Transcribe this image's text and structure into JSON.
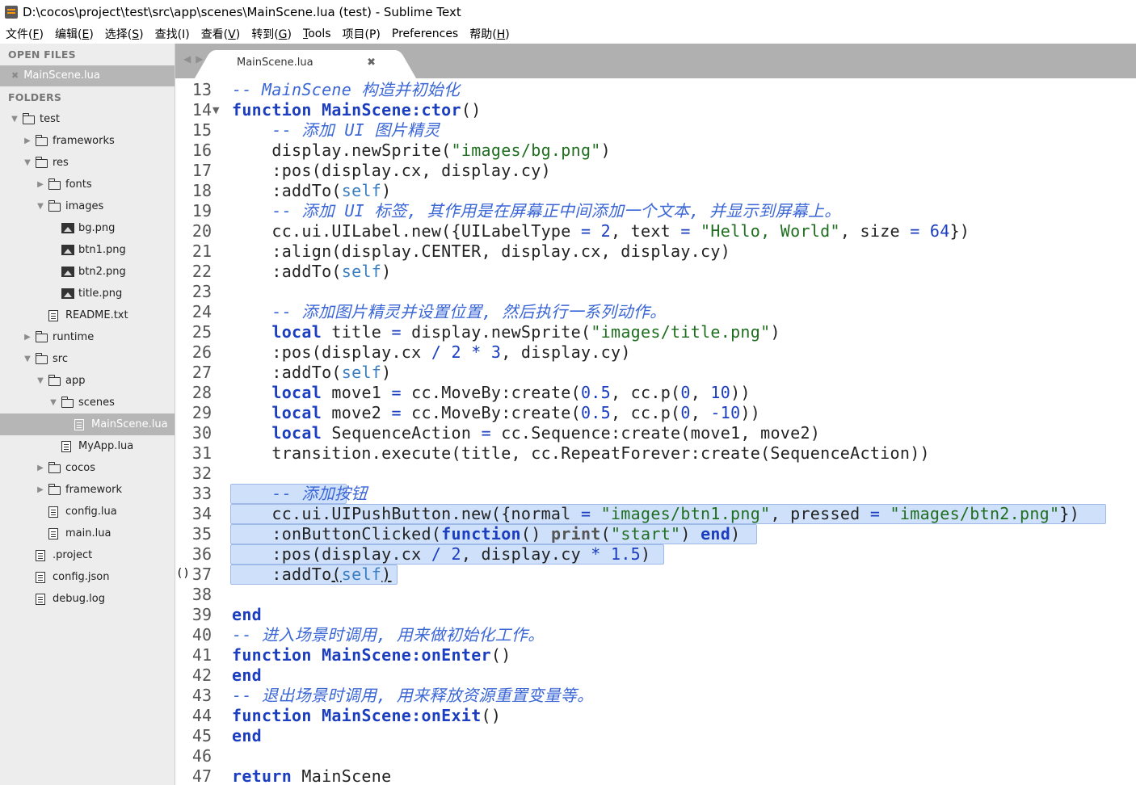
{
  "window": {
    "title": "D:\\cocos\\project\\test\\src\\app\\scenes\\MainScene.lua (test) - Sublime Text"
  },
  "menu": [
    {
      "label": "文件(",
      "key": "F",
      "end": ")"
    },
    {
      "label": "编辑(",
      "key": "E",
      "end": ")"
    },
    {
      "label": "选择(",
      "key": "S",
      "end": ")"
    },
    {
      "label": "查找(I)",
      "key": "",
      "end": ""
    },
    {
      "label": "查看(",
      "key": "V",
      "end": ")"
    },
    {
      "label": "转到(",
      "key": "G",
      "end": ")"
    },
    {
      "label": "",
      "key": "T",
      "end": "ools"
    },
    {
      "label": "项目(P)",
      "key": "",
      "end": ""
    },
    {
      "label": "Preferences",
      "key": "",
      "end": ""
    },
    {
      "label": "帮助(",
      "key": "H",
      "end": ")"
    }
  ],
  "sidebar": {
    "open_files_title": "OPEN FILES",
    "open_file": "MainScene.lua",
    "folders_title": "FOLDERS",
    "tree": [
      {
        "label": "test",
        "type": "folder-open",
        "depth": 0
      },
      {
        "label": "frameworks",
        "type": "folder",
        "depth": 1
      },
      {
        "label": "res",
        "type": "folder-open",
        "depth": 1
      },
      {
        "label": "fonts",
        "type": "folder",
        "depth": 2
      },
      {
        "label": "images",
        "type": "folder-open",
        "depth": 2
      },
      {
        "label": "bg.png",
        "type": "image",
        "depth": 3
      },
      {
        "label": "btn1.png",
        "type": "image",
        "depth": 3
      },
      {
        "label": "btn2.png",
        "type": "image",
        "depth": 3
      },
      {
        "label": "title.png",
        "type": "image",
        "depth": 3
      },
      {
        "label": "README.txt",
        "type": "file",
        "depth": 2
      },
      {
        "label": "runtime",
        "type": "folder",
        "depth": 1
      },
      {
        "label": "src",
        "type": "folder-open",
        "depth": 1
      },
      {
        "label": "app",
        "type": "folder-open",
        "depth": 2
      },
      {
        "label": "scenes",
        "type": "folder-open",
        "depth": 3
      },
      {
        "label": "MainScene.lua",
        "type": "file",
        "depth": 4,
        "selected": true
      },
      {
        "label": "MyApp.lua",
        "type": "file",
        "depth": 3
      },
      {
        "label": "cocos",
        "type": "folder",
        "depth": 2
      },
      {
        "label": "framework",
        "type": "folder",
        "depth": 2
      },
      {
        "label": "config.lua",
        "type": "file",
        "depth": 2
      },
      {
        "label": "main.lua",
        "type": "file",
        "depth": 2
      },
      {
        "label": ".project",
        "type": "file",
        "depth": 1
      },
      {
        "label": "config.json",
        "type": "file",
        "depth": 1
      },
      {
        "label": "debug.log",
        "type": "file",
        "depth": 1
      }
    ]
  },
  "tab": {
    "label": "MainScene.lua",
    "close": "✖"
  },
  "editor": {
    "first_line": 13,
    "lines": [
      [
        [
          "c",
          "-- MainScene 构造并初始化"
        ]
      ],
      [
        [
          "k",
          "function "
        ],
        [
          "f",
          "MainScene:ctor"
        ],
        [
          "p",
          "()"
        ]
      ],
      [
        [
          "p",
          "    "
        ],
        [
          "c",
          "-- 添加 UI 图片精灵"
        ]
      ],
      [
        [
          "p",
          "    display.newSprite("
        ],
        [
          "s",
          "\"images/bg.png\""
        ],
        [
          "p",
          ")"
        ]
      ],
      [
        [
          "p",
          "    :pos(display.cx, display.cy)"
        ]
      ],
      [
        [
          "p",
          "    :addTo("
        ],
        [
          "self",
          "self"
        ],
        [
          "p",
          ")"
        ]
      ],
      [
        [
          "p",
          "    "
        ],
        [
          "c",
          "-- 添加 UI 标签, 其作用是在屏幕正中间添加一个文本, 并显示到屏幕上。"
        ]
      ],
      [
        [
          "p",
          "    cc.ui.UILabel.new({UILabelType "
        ],
        [
          "o",
          "="
        ],
        [
          "p",
          " "
        ],
        [
          "n",
          "2"
        ],
        [
          "p",
          ", text "
        ],
        [
          "o",
          "="
        ],
        [
          "p",
          " "
        ],
        [
          "s",
          "\"Hello, World\""
        ],
        [
          "p",
          ", size "
        ],
        [
          "o",
          "="
        ],
        [
          "p",
          " "
        ],
        [
          "n",
          "64"
        ],
        [
          "p",
          "})"
        ]
      ],
      [
        [
          "p",
          "    :align(display.CENTER, display.cx, display.cy)"
        ]
      ],
      [
        [
          "p",
          "    :addTo("
        ],
        [
          "self",
          "self"
        ],
        [
          "p",
          ")"
        ]
      ],
      [
        [
          "p",
          ""
        ]
      ],
      [
        [
          "p",
          "    "
        ],
        [
          "c",
          "-- 添加图片精灵并设置位置, 然后执行一系列动作。"
        ]
      ],
      [
        [
          "p",
          "    "
        ],
        [
          "k",
          "local"
        ],
        [
          "p",
          " title "
        ],
        [
          "o",
          "="
        ],
        [
          "p",
          " display.newSprite("
        ],
        [
          "s",
          "\"images/title.png\""
        ],
        [
          "p",
          ")"
        ]
      ],
      [
        [
          "p",
          "    :pos(display.cx "
        ],
        [
          "o",
          "/"
        ],
        [
          "p",
          " "
        ],
        [
          "n",
          "2"
        ],
        [
          "p",
          " "
        ],
        [
          "o",
          "*"
        ],
        [
          "p",
          " "
        ],
        [
          "n",
          "3"
        ],
        [
          "p",
          ", display.cy)"
        ]
      ],
      [
        [
          "p",
          "    :addTo("
        ],
        [
          "self",
          "self"
        ],
        [
          "p",
          ")"
        ]
      ],
      [
        [
          "p",
          "    "
        ],
        [
          "k",
          "local"
        ],
        [
          "p",
          " move1 "
        ],
        [
          "o",
          "="
        ],
        [
          "p",
          " cc.MoveBy:create("
        ],
        [
          "n",
          "0.5"
        ],
        [
          "p",
          ", cc.p("
        ],
        [
          "n",
          "0"
        ],
        [
          "p",
          ", "
        ],
        [
          "n",
          "10"
        ],
        [
          "p",
          "))"
        ]
      ],
      [
        [
          "p",
          "    "
        ],
        [
          "k",
          "local"
        ],
        [
          "p",
          " move2 "
        ],
        [
          "o",
          "="
        ],
        [
          "p",
          " cc.MoveBy:create("
        ],
        [
          "n",
          "0.5"
        ],
        [
          "p",
          ", cc.p("
        ],
        [
          "n",
          "0"
        ],
        [
          "p",
          ", "
        ],
        [
          "n",
          "-10"
        ],
        [
          "p",
          "))"
        ]
      ],
      [
        [
          "p",
          "    "
        ],
        [
          "k",
          "local"
        ],
        [
          "p",
          " SequenceAction "
        ],
        [
          "o",
          "="
        ],
        [
          "p",
          " cc.Sequence:create(move1, move2)"
        ]
      ],
      [
        [
          "p",
          "    transition.execute(title, cc.RepeatForever:create(SequenceAction))"
        ]
      ],
      [
        [
          "p",
          ""
        ]
      ],
      [
        [
          "p",
          "    "
        ],
        [
          "c",
          "-- 添加按钮"
        ]
      ],
      [
        [
          "p",
          "    cc.ui.UIPushButton.new({normal "
        ],
        [
          "o",
          "="
        ],
        [
          "p",
          " "
        ],
        [
          "s",
          "\"images/btn1.png\""
        ],
        [
          "p",
          ", pressed "
        ],
        [
          "o",
          "="
        ],
        [
          "p",
          " "
        ],
        [
          "s",
          "\"images/btn2.png\""
        ],
        [
          "p",
          "})"
        ]
      ],
      [
        [
          "p",
          "    :onButtonClicked("
        ],
        [
          "k",
          "function"
        ],
        [
          "p",
          "() "
        ],
        [
          "pr",
          "print"
        ],
        [
          "p",
          "("
        ],
        [
          "s",
          "\"start\""
        ],
        [
          "p",
          ") "
        ],
        [
          "k",
          "end"
        ],
        [
          "p",
          ")"
        ]
      ],
      [
        [
          "p",
          "    :pos(display.cx "
        ],
        [
          "o",
          "/"
        ],
        [
          "p",
          " "
        ],
        [
          "n",
          "2"
        ],
        [
          "p",
          ", display.cy "
        ],
        [
          "o",
          "*"
        ],
        [
          "p",
          " "
        ],
        [
          "n",
          "1.5"
        ],
        [
          "p",
          ")"
        ]
      ],
      [
        [
          "p",
          "    :addTo"
        ],
        [
          "ul",
          "("
        ],
        [
          "self",
          "self"
        ],
        [
          "ul",
          ")"
        ]
      ],
      [
        [
          "p",
          ""
        ]
      ],
      [
        [
          "k",
          "end"
        ]
      ],
      [
        [
          "c",
          "-- 进入场景时调用, 用来做初始化工作。"
        ]
      ],
      [
        [
          "k",
          "function "
        ],
        [
          "f",
          "MainScene:onEnter"
        ],
        [
          "p",
          "()"
        ]
      ],
      [
        [
          "k",
          "end"
        ]
      ],
      [
        [
          "c",
          "-- 退出场景时调用, 用来释放资源重置变量等。"
        ]
      ],
      [
        [
          "k",
          "function "
        ],
        [
          "f",
          "MainScene:onExit"
        ],
        [
          "p",
          "()"
        ]
      ],
      [
        [
          "k",
          "end"
        ]
      ],
      [
        [
          "p",
          ""
        ]
      ],
      [
        [
          "k",
          "return"
        ],
        [
          "p",
          " MainScene"
        ]
      ]
    ],
    "fold_marker": "▼",
    "bracket_marker": "()"
  }
}
